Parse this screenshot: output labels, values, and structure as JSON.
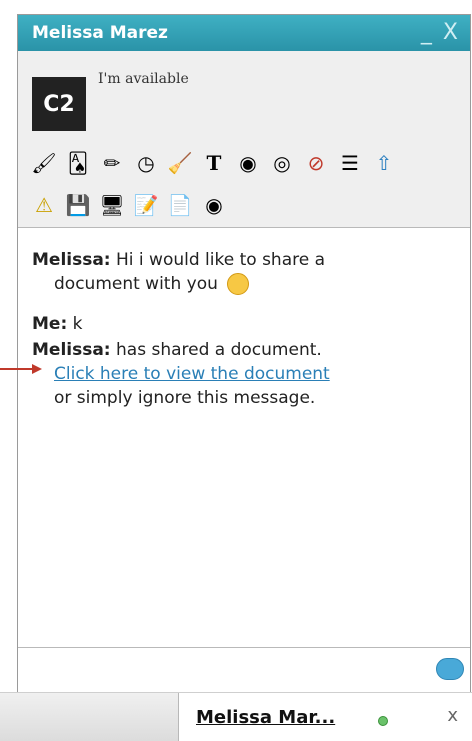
{
  "chat": {
    "title": "Melissa Marez",
    "window_controls": "_ X",
    "avatar_text": "C2",
    "status": "I'm available"
  },
  "tools_row1": [
    "draw-icon",
    "cards-icon",
    "pencil-icon",
    "clock-icon",
    "broom-icon",
    "text-icon",
    "webcam-icon",
    "audio-icon",
    "block-icon",
    "notes-icon",
    "upload-icon"
  ],
  "tools_row2": [
    "warning-icon",
    "save-icon",
    "screen-icon",
    "whiteboard-icon",
    "copy-icon",
    "webcam-share-icon"
  ],
  "messages": {
    "m1_sender": "Melissa:",
    "m1_text": "Hi i would like to share a",
    "m1_text2": "document with you",
    "m2_sender": "Me:",
    "m2_text": "k",
    "m3_sender": "Melissa:",
    "m3_text": "has shared a document.",
    "m3_link": "Click here to view the document",
    "m3_text2": "or simply ignore this message."
  },
  "tab": {
    "name": "Melissa Mar...",
    "close": "x"
  }
}
